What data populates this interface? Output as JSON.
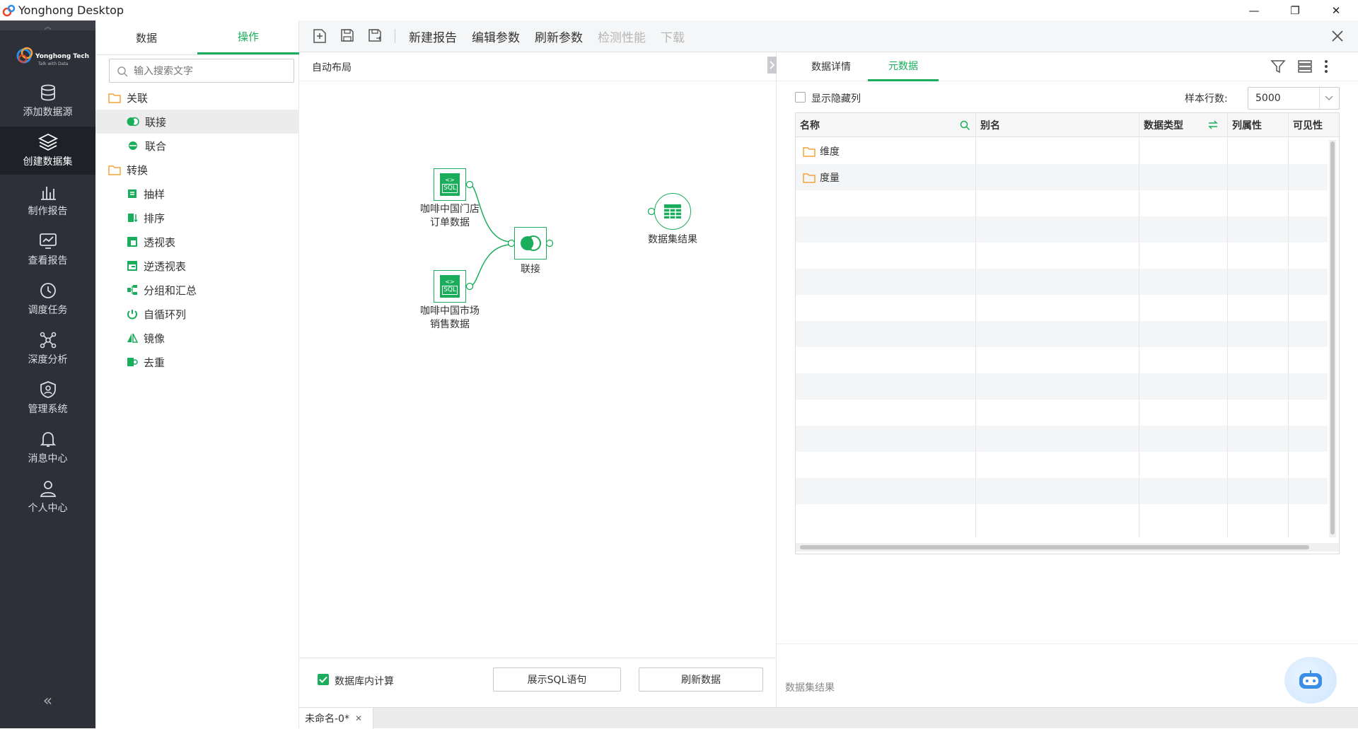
{
  "window": {
    "title": "Yonghong Desktop",
    "minimize_glyph": "—",
    "restore_glyph": "❐",
    "close_glyph": "✕"
  },
  "nav": {
    "logo_brand": "Yonghong Tech",
    "logo_tagline": "Talk with Data",
    "items": [
      {
        "label": "添加数据源",
        "icon": "database-icon"
      },
      {
        "label": "创建数据集",
        "icon": "layers-icon",
        "active": true
      },
      {
        "label": "制作报告",
        "icon": "chart-icon"
      },
      {
        "label": "查看报告",
        "icon": "monitor-chart-icon"
      },
      {
        "label": "调度任务",
        "icon": "clock-icon"
      },
      {
        "label": "深度分析",
        "icon": "network-icon"
      },
      {
        "label": "管理系统",
        "icon": "shield-user-icon"
      },
      {
        "label": "消息中心",
        "icon": "bell-icon"
      },
      {
        "label": "个人中心",
        "icon": "user-icon"
      }
    ],
    "collapse_glyph": "«"
  },
  "side": {
    "tabs": [
      {
        "label": "数据"
      },
      {
        "label": "操作",
        "active": true
      }
    ],
    "search_placeholder": "输入搜索文字",
    "tree": [
      {
        "label": "关联",
        "type": "folder",
        "level": 0
      },
      {
        "label": "联接",
        "type": "join",
        "level": 1,
        "selected": true
      },
      {
        "label": "联合",
        "type": "union",
        "level": 1
      },
      {
        "label": "转换",
        "type": "folder",
        "level": 0
      },
      {
        "label": "抽样",
        "type": "op",
        "level": 1
      },
      {
        "label": "排序",
        "type": "op",
        "level": 1
      },
      {
        "label": "透视表",
        "type": "op",
        "level": 1
      },
      {
        "label": "逆透视表",
        "type": "op",
        "level": 1
      },
      {
        "label": "分组和汇总",
        "type": "op",
        "level": 1
      },
      {
        "label": "自循环列",
        "type": "op",
        "level": 1
      },
      {
        "label": "镜像",
        "type": "op",
        "level": 1
      },
      {
        "label": "去重",
        "type": "op",
        "level": 1
      }
    ]
  },
  "toolbar": {
    "new_report": "新建报告",
    "edit_params": "编辑参数",
    "refresh_params": "刷新参数",
    "check_perf": "检测性能",
    "download": "下载"
  },
  "canvas": {
    "layout_label": "自动布局",
    "nodes": {
      "sql1_line1": "咖啡中国门店",
      "sql1_line2": "订单数据",
      "sql2_line1": "咖啡中国市场",
      "sql2_line2": "销售数据",
      "join": "联接",
      "result": "数据集结果",
      "sql_badge": "SQL"
    },
    "db_compute_label": "数据库内计算",
    "db_compute_checked": true,
    "show_sql_button": "展示SQL语句",
    "refresh_data_button": "刷新数据"
  },
  "right": {
    "tabs": [
      {
        "label": "数据详情"
      },
      {
        "label": "元数据",
        "active": true
      }
    ],
    "show_hidden_label": "显示隐藏列",
    "sample_rows_label": "样本行数:",
    "sample_rows_value": "5000",
    "columns": {
      "name": "名称",
      "alias": "别名",
      "data_type": "数据类型",
      "col_attr": "列属性",
      "visibility": "可见性"
    },
    "rows": [
      {
        "name": "维度"
      },
      {
        "name": "度量"
      }
    ],
    "footer_label": "数据集结果"
  },
  "bottom": {
    "tab_label": "未命名-0*",
    "tab_close": "✕"
  },
  "colors": {
    "accent": "#1aad5b",
    "nav_bg": "#2d3039",
    "folder": "#f3a33a"
  }
}
